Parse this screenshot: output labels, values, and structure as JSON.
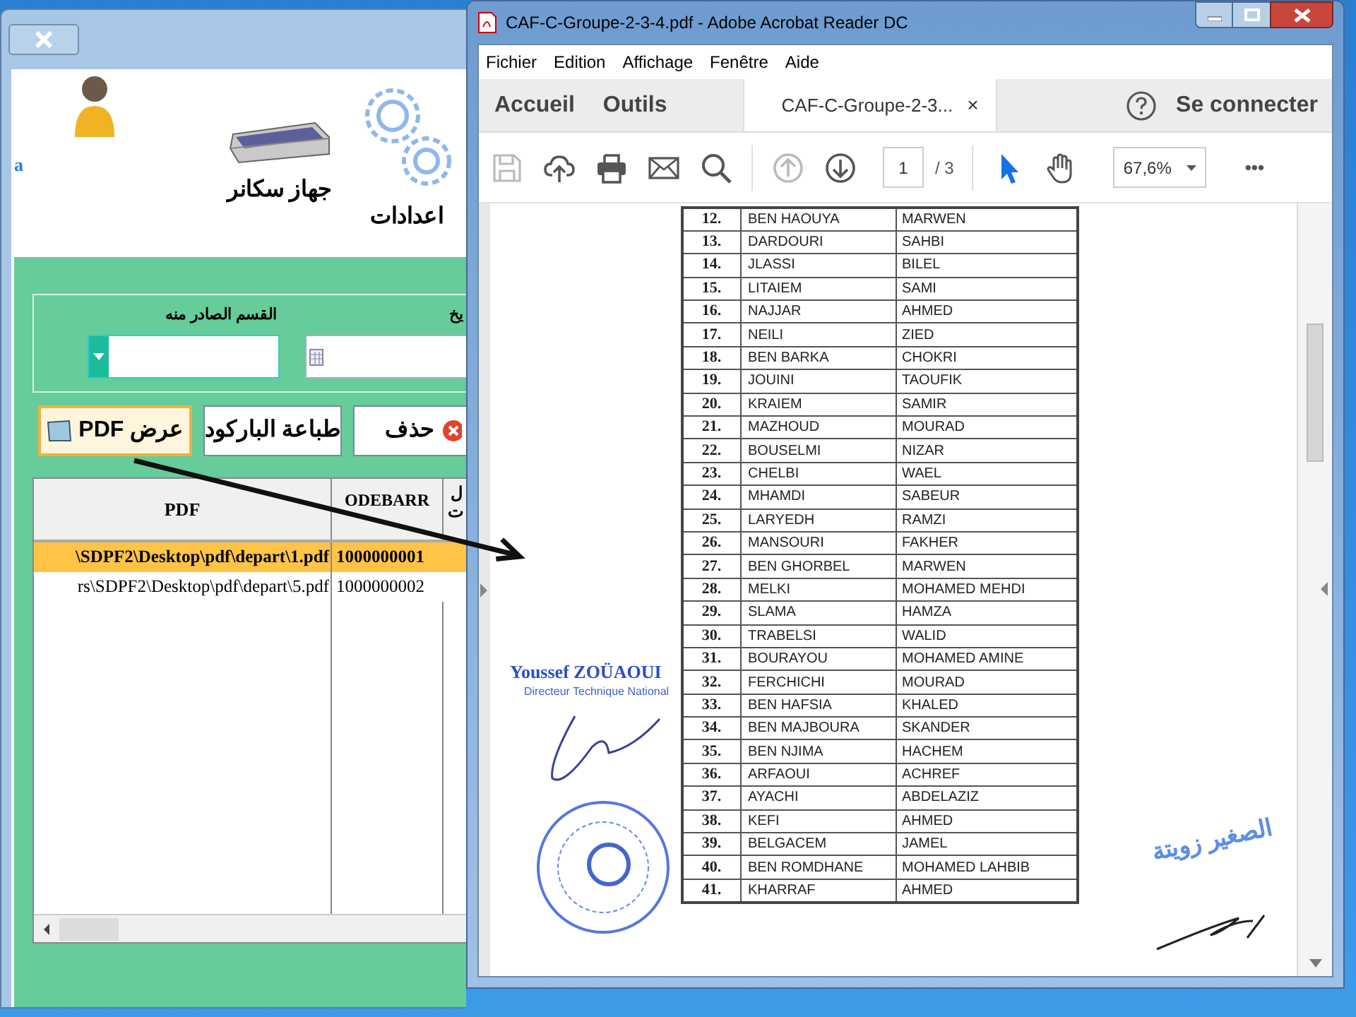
{
  "app_window": {
    "user_label": "a",
    "toolbar": [
      {
        "kind": "scanner",
        "label": "جهاز سكانر"
      },
      {
        "kind": "settings",
        "label": "اعدادات"
      }
    ],
    "filters": [
      {
        "kind": "date",
        "label": "يخ"
      },
      {
        "kind": "dropdown",
        "label": "القسم الصادر منه"
      }
    ],
    "buttons": [
      {
        "kind": "delete",
        "label": "حذف",
        "focused": false
      },
      {
        "kind": "print-barcode",
        "label": "طباعة الباركود",
        "focused": false
      },
      {
        "kind": "view-pdf",
        "label": "عرض PDF",
        "focused": true
      }
    ],
    "grid": {
      "columns": [
        "PDF",
        "ODEBARR",
        "ل ت"
      ],
      "rows": [
        {
          "cells": [
            "\\SDPF2\\Desktop\\pdf\\depart\\1.pdf",
            "1000000001"
          ],
          "selected": true
        },
        {
          "cells": [
            "rs\\SDPF2\\Desktop\\pdf\\depart\\5.pdf",
            "1000000002"
          ],
          "selected": false
        }
      ]
    }
  },
  "pdf_viewer": {
    "title": "CAF-C-Groupe-2-3-4.pdf - Adobe Acrobat Reader DC",
    "menu": [
      "Fichier",
      "Edition",
      "Affichage",
      "Fenêtre",
      "Aide"
    ],
    "tabs": [
      {
        "kind": "nav",
        "label": "Accueil",
        "selected": false
      },
      {
        "kind": "nav",
        "label": "Outils",
        "selected": false
      },
      {
        "kind": "document",
        "label": "CAF-C-Groupe-2-3...",
        "close": "×",
        "selected": true
      }
    ],
    "sign_in": "Se connecter",
    "tools": [
      {
        "kind": "save",
        "disabled": true,
        "selected": false
      },
      {
        "kind": "upload",
        "disabled": false,
        "selected": false
      },
      {
        "kind": "print",
        "disabled": false,
        "selected": false
      },
      {
        "kind": "mail",
        "disabled": false,
        "selected": false
      },
      {
        "kind": "search",
        "disabled": false,
        "selected": false
      },
      {
        "kind": "page-up",
        "disabled": true,
        "selected": false
      },
      {
        "kind": "page-down",
        "disabled": false,
        "selected": false
      },
      {
        "kind": "select",
        "disabled": false,
        "selected": true
      },
      {
        "kind": "hand",
        "disabled": false,
        "selected": false
      }
    ],
    "page_number": "1",
    "page_total": "/ 3",
    "zoom": "67,6%",
    "more": "•••",
    "document": {
      "rows": [
        {
          "number": "12.",
          "last_name": "BEN HAOUYA",
          "first_name": "MARWEN"
        },
        {
          "number": "13.",
          "last_name": "DARDOURI",
          "first_name": "SAHBI"
        },
        {
          "number": "14.",
          "last_name": "JLASSI",
          "first_name": "BILEL"
        },
        {
          "number": "15.",
          "last_name": "LITAIEM",
          "first_name": "SAMI"
        },
        {
          "number": "16.",
          "last_name": "NAJJAR",
          "first_name": "AHMED"
        },
        {
          "number": "17.",
          "last_name": "NEILI",
          "first_name": "ZIED"
        },
        {
          "number": "18.",
          "last_name": "BEN BARKA",
          "first_name": "CHOKRI"
        },
        {
          "number": "19.",
          "last_name": "JOUINI",
          "first_name": "TAOUFIK"
        },
        {
          "number": "20.",
          "last_name": "KRAIEM",
          "first_name": "SAMIR"
        },
        {
          "number": "21.",
          "last_name": "MAZHOUD",
          "first_name": "MOURAD"
        },
        {
          "number": "22.",
          "last_name": "BOUSELMI",
          "first_name": "NIZAR"
        },
        {
          "number": "23.",
          "last_name": "CHELBI",
          "first_name": "WAEL"
        },
        {
          "number": "24.",
          "last_name": "MHAMDI",
          "first_name": "SABEUR"
        },
        {
          "number": "25.",
          "last_name": "LARYEDH",
          "first_name": "RAMZI"
        },
        {
          "number": "26.",
          "last_name": "MANSOURI",
          "first_name": "FAKHER"
        },
        {
          "number": "27.",
          "last_name": "BEN GHORBEL",
          "first_name": "MARWEN"
        },
        {
          "number": "28.",
          "last_name": "MELKI",
          "first_name": "MOHAMED MEHDI"
        },
        {
          "number": "29.",
          "last_name": "SLAMA",
          "first_name": "HAMZA"
        },
        {
          "number": "30.",
          "last_name": "TRABELSI",
          "first_name": "WALID"
        },
        {
          "number": "31.",
          "last_name": "BOURAYOU",
          "first_name": "MOHAMED AMINE"
        },
        {
          "number": "32.",
          "last_name": "FERCHICHI",
          "first_name": "MOURAD"
        },
        {
          "number": "33.",
          "last_name": "BEN HAFSIA",
          "first_name": "KHALED"
        },
        {
          "number": "34.",
          "last_name": "BEN MAJBOURA",
          "first_name": "SKANDER"
        },
        {
          "number": "35.",
          "last_name": "BEN NJIMA",
          "first_name": "HACHEM"
        },
        {
          "number": "36.",
          "last_name": "ARFAOUI",
          "first_name": "ACHREF"
        },
        {
          "number": "37.",
          "last_name": "AYACHI",
          "first_name": "ABDELAZIZ"
        },
        {
          "number": "38.",
          "last_name": "KEFI",
          "first_name": "AHMED"
        },
        {
          "number": "39.",
          "last_name": "BELGACEM",
          "first_name": "JAMEL"
        },
        {
          "number": "40.",
          "last_name": "BEN ROMDHANE",
          "first_name": "MOHAMED LAHBIB"
        },
        {
          "number": "41.",
          "last_name": "KHARRAF",
          "first_name": "AHMED"
        }
      ],
      "stamp_left": {
        "name": "Youssef ZOÜAOUI",
        "role": "Directeur Technique National"
      },
      "stamp_right": {
        "name": "الصغير زويتة"
      }
    }
  }
}
